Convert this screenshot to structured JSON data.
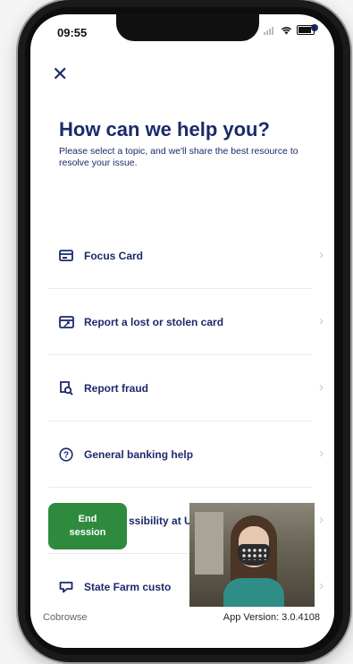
{
  "status_bar": {
    "time": "09:55"
  },
  "header": {
    "close_icon": "close-icon",
    "title": "How can we help you?",
    "subtitle": "Please select a topic, and we'll share the best resource to resolve your issue."
  },
  "menu": {
    "items": [
      {
        "label": "Focus Card",
        "icon": "card-icon"
      },
      {
        "label": "Report a lost or stolen card",
        "icon": "card-report-icon"
      },
      {
        "label": "Report fraud",
        "icon": "fraud-icon"
      },
      {
        "label": "General banking help",
        "icon": "question-icon"
      },
      {
        "label": "ssibility at U",
        "icon": "accessibility-icon"
      },
      {
        "label": "State Farm custo",
        "icon": "chat-icon"
      }
    ]
  },
  "end_session": {
    "line1": "End",
    "line2": "session"
  },
  "footer": {
    "left": "Cobrowse",
    "right": "App Version: 3.0.4108"
  },
  "colors": {
    "primary": "#1b2a6b",
    "end_session": "#2e8b3e"
  }
}
